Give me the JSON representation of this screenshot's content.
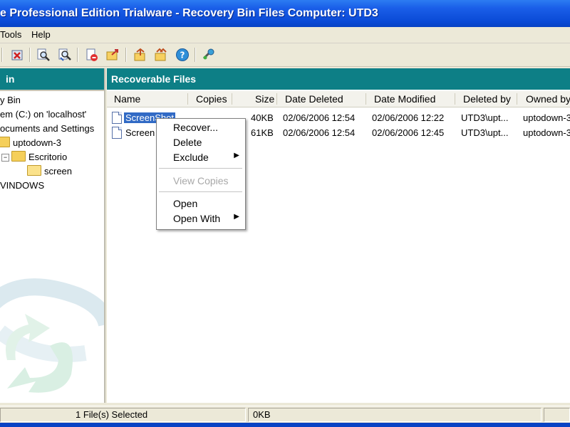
{
  "window": {
    "title": "e Professional Edition Trialware - Recovery Bin Files   Computer: UTD3"
  },
  "menu": {
    "items": [
      "Tools",
      "Help"
    ]
  },
  "toolbar": {
    "icons": [
      "delete-icon",
      "search-icon",
      "search-advanced-icon",
      "document-delete-icon",
      "export-icon",
      "recover-icon",
      "recover-all-icon",
      "help-icon",
      "settings-icon"
    ]
  },
  "left_pane": {
    "header": "in",
    "tree": [
      {
        "label": "y Bin"
      },
      {
        "label": "em (C:) on 'localhost'"
      },
      {
        "label": "ocuments and Settings"
      },
      {
        "label": "uptodown-3"
      },
      {
        "label": "Escritorio"
      },
      {
        "label": "screen"
      },
      {
        "label": "VINDOWS"
      }
    ]
  },
  "right_pane": {
    "header": "Recoverable Files",
    "columns": [
      "Name",
      "Copies",
      "Size",
      "Date Deleted",
      "Date Modified",
      "Deleted by",
      "Owned by"
    ],
    "rows": [
      {
        "name": "ScreenShot",
        "copies": "",
        "size": "40KB",
        "date_deleted": "02/06/2006 12:54",
        "date_modified": "02/06/2006 12:22",
        "deleted_by": "UTD3\\upt...",
        "owned_by": "uptodown-3"
      },
      {
        "name": "Screen",
        "copies": "",
        "size": "61KB",
        "date_deleted": "02/06/2006 12:54",
        "date_modified": "02/06/2006 12:45",
        "deleted_by": "UTD3\\upt...",
        "owned_by": "uptodown-3"
      }
    ]
  },
  "context_menu": {
    "items": [
      {
        "label": "Recover..."
      },
      {
        "label": "Delete"
      },
      {
        "label": "Exclude"
      },
      {
        "label": "View Copies"
      },
      {
        "label": "Open"
      },
      {
        "label": "Open With"
      }
    ]
  },
  "status": {
    "selected": "1 File(s) Selected",
    "size": "0KB"
  },
  "colors": {
    "title_bar": "#0a4ad6",
    "pane_header": "#0d7f86",
    "selection": "#316ac5"
  }
}
